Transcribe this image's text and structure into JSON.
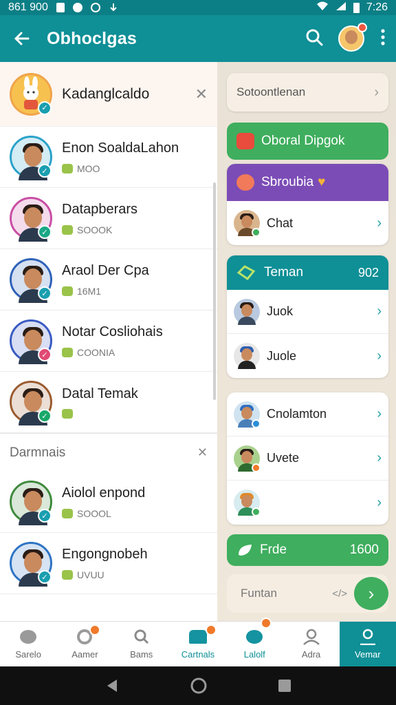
{
  "status_bar": {
    "left_text": "861 900",
    "time": "7:26"
  },
  "app_bar": {
    "title": "Obhoclgas"
  },
  "pinned": {
    "name": "Kadanglcaldo"
  },
  "contacts": [
    {
      "name": "Enon SoaldaLahon",
      "sub": "MOO",
      "ring": "#2aa2c9",
      "check": "#1a9fb0"
    },
    {
      "name": "Datapberars",
      "sub": "SOOOK",
      "ring": "#c94ea4",
      "check": "#1aa886"
    },
    {
      "name": "Araol Der Cpa",
      "sub": "16M1",
      "ring": "#2f62b8",
      "check": "#1a9fb0"
    },
    {
      "name": "Notar Cosliohais",
      "sub": "COONIA",
      "ring": "#3a5bc2",
      "check": "#e04a74"
    },
    {
      "name": "Datal Temak",
      "sub": "",
      "ring": "#9a5b2f",
      "check": "#1aa86a"
    }
  ],
  "section": {
    "title": "Darmnais"
  },
  "section_contacts": [
    {
      "name": "Aiolol enpond",
      "sub": "SOOOL",
      "ring": "#3f8a3d",
      "check": "#1a9fb0"
    },
    {
      "name": "Engongnobeh",
      "sub": "UVUU",
      "ring": "#2d74c4",
      "check": "#1a9fb0"
    }
  ],
  "right": {
    "top_card": {
      "label": "Sotoontlenan"
    },
    "green_pill": {
      "label": "Oboral Dipgok"
    },
    "purple_card": {
      "header": "Sbroubia",
      "rows": [
        {
          "label": "Chat"
        }
      ]
    },
    "teal_card": {
      "header": "Teman",
      "count": "902",
      "rows": [
        {
          "label": "Juok"
        },
        {
          "label": "Juole"
        }
      ]
    },
    "people_card": {
      "rows": [
        {
          "label": "Cnolamton"
        },
        {
          "label": "Uvete"
        },
        {
          "label": ""
        }
      ]
    },
    "file_pill": {
      "label": "Frde",
      "count": "1600"
    },
    "footer": {
      "label": "Funtan",
      "hint": "</>"
    }
  },
  "bottom_nav": [
    {
      "label": "Sarelo"
    },
    {
      "label": "Aamer"
    },
    {
      "label": "Bams"
    },
    {
      "label": "Cartnals"
    },
    {
      "label": "Lalolf"
    },
    {
      "label": "Adra"
    },
    {
      "label": "Vemar"
    }
  ],
  "colors": {
    "teal": "#0f8f96",
    "green": "#3fae5e",
    "purple": "#7b4cb6",
    "orange": "#f07a2a"
  }
}
